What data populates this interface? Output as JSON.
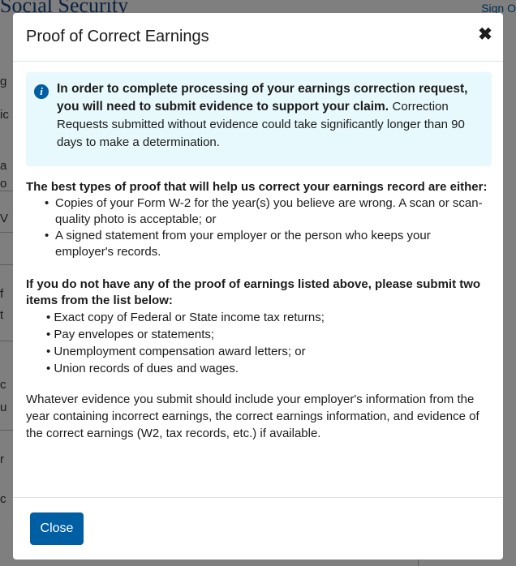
{
  "background": {
    "header_title": "Social Security",
    "signin_label": "Sign O",
    "fragments": [
      "g",
      "ic",
      "a",
      "o",
      "V",
      "f",
      "t",
      "c",
      "u",
      "r",
      "c"
    ]
  },
  "modal": {
    "title": "Proof of Correct Earnings",
    "close_icon": "close-x-icon",
    "alert": {
      "icon": "info-circle-icon",
      "bold_text": "In order to complete processing of your earnings correction request, you will need to submit evidence to support your claim.",
      "text": "Correction Requests submitted without evidence could take significantly longer than 90 days to make a determination."
    },
    "section1": {
      "heading": "The best types of proof  that will help us correct your earnings record are either:",
      "items": [
        "Copies of your Form W-2 for the year(s) you believe are wrong. A scan or scan-quality photo is acceptable; or",
        " A signed statement from your employer or the person who keeps your employer's records."
      ]
    },
    "section2": {
      "heading": "If you do not have any of the proof of earnings listed above, please submit two items from the list below:",
      "items": [
        "• Exact copy of Federal or State income tax returns;",
        "• Pay envelopes or statements;",
        "• Unemployment compensation award letters; or",
        "• Union records of dues and wages."
      ]
    },
    "closing": "Whatever evidence you submit should include your employer's information from the year containing incorrect earnings, the correct earnings information, and evidence of the correct earnings (W2, tax records, etc.) if available.",
    "close_button_label": "Close"
  },
  "colors": {
    "primary": "#005ea2",
    "alert_bg": "#e7f9fc",
    "overlay": "rgba(0,0,0,0.5)"
  }
}
